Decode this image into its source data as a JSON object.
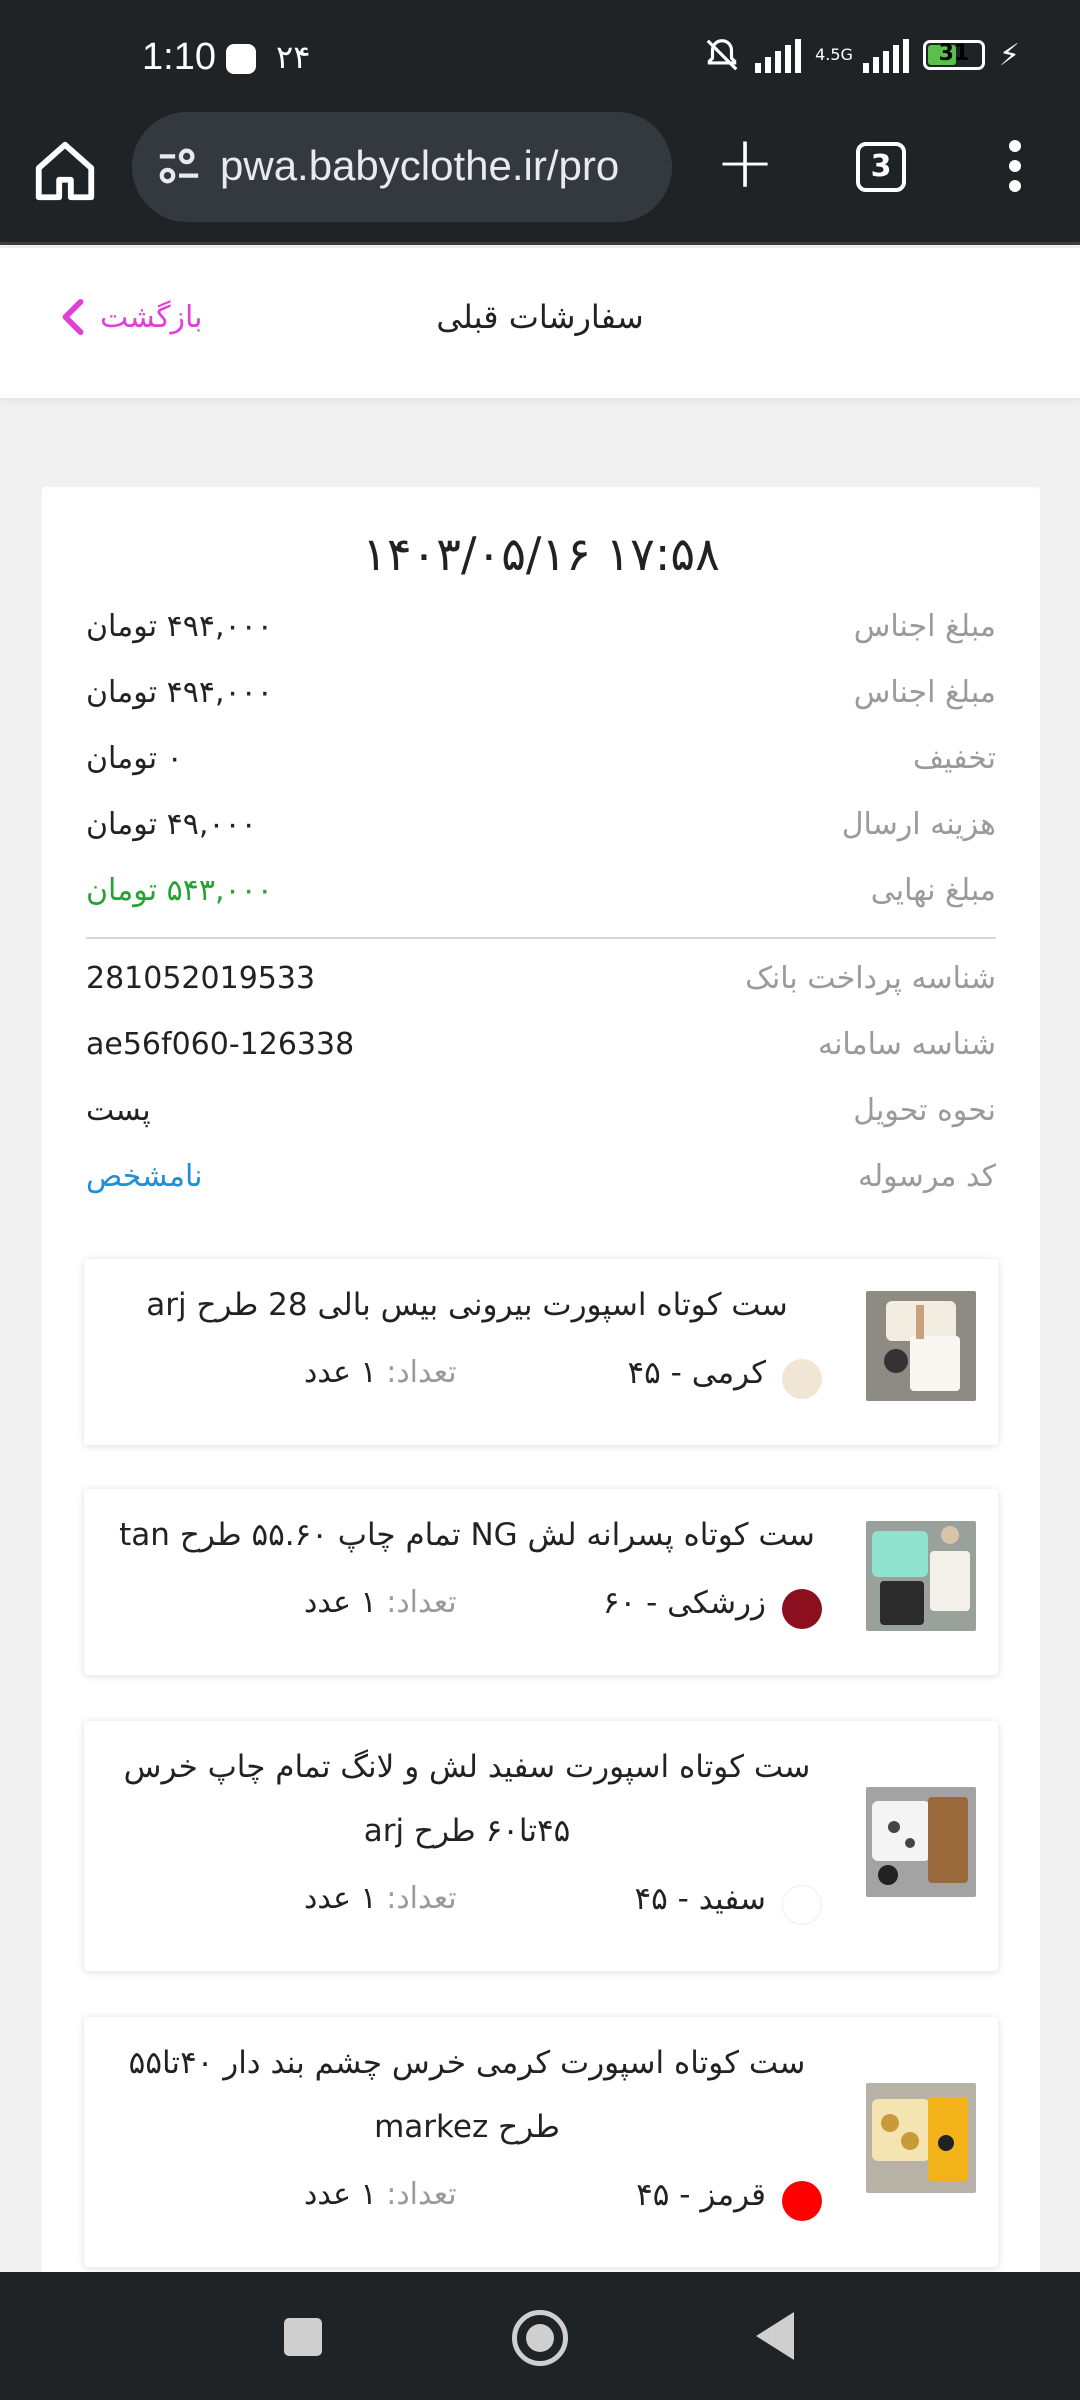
{
  "status_bar": {
    "time": "1:10",
    "date": "۲۴",
    "network": "4.5G",
    "battery": "31"
  },
  "browser": {
    "url": "pwa.babyclothe.ir/pro",
    "tab_count": "3"
  },
  "header": {
    "title": "سفارشات قبلی",
    "back_label": "بازگشت"
  },
  "order": {
    "datetime": "۱۴۰۳/۰۵/۱۶ ۱۷:۵۸",
    "rows": [
      {
        "label": "مبلغ اجناس",
        "value": "۴۹۴,۰۰۰ تومان"
      },
      {
        "label": "مبلغ اجناس",
        "value": "۴۹۴,۰۰۰ تومان"
      },
      {
        "label": "تخفیف",
        "value": "۰ تومان"
      },
      {
        "label": "هزینه ارسال",
        "value": "۴۹,۰۰۰ تومان"
      },
      {
        "label": "مبلغ نهایی",
        "value": "۵۴۳,۰۰۰ تومان"
      },
      {
        "label": "شناسه پرداخت بانک",
        "value": "281052019533"
      },
      {
        "label": "شناسه سامانه",
        "value": "ae56f060-126338"
      },
      {
        "label": "نحوه تحویل",
        "value": "پست"
      },
      {
        "label": "کد مرسوله",
        "value": "نامشخص"
      }
    ],
    "accent_colors": {
      "final_amount": "#27a234",
      "tracking": "#1e8fd8"
    }
  },
  "items": [
    {
      "name": "ست کوتاه اسپورت بیرونی بیس بالی 28 طرح arj",
      "color_name": "کرمی",
      "size": "۴۵",
      "color_hex": "#f1e6d4",
      "qty_label": "تعداد:",
      "qty_value": "۱ عدد"
    },
    {
      "name": "ست کوتاه پسرانه لش NG تمام چاپ ۵۵.۶۰ طرح tan",
      "color_name": "زرشکی",
      "size": "۶۰",
      "color_hex": "#8b0f1f",
      "qty_label": "تعداد:",
      "qty_value": "۱ عدد"
    },
    {
      "name": "ست کوتاه اسپورت سفید لش و لانگ تمام چاپ خرس ۴۵تا۶۰ طرح arj",
      "color_name": "سفید",
      "size": "۴۵",
      "color_hex": "#ffffff",
      "qty_label": "تعداد:",
      "qty_value": "۱ عدد"
    },
    {
      "name": "ست کوتاه اسپورت کرمی خرس چشم بند دار ۴۰تا۵۵ طرح markez",
      "color_name": "قرمز",
      "size": "۴۵",
      "color_hex": "#ff0000",
      "qty_label": "تعداد:",
      "qty_value": "۱ عدد"
    }
  ]
}
